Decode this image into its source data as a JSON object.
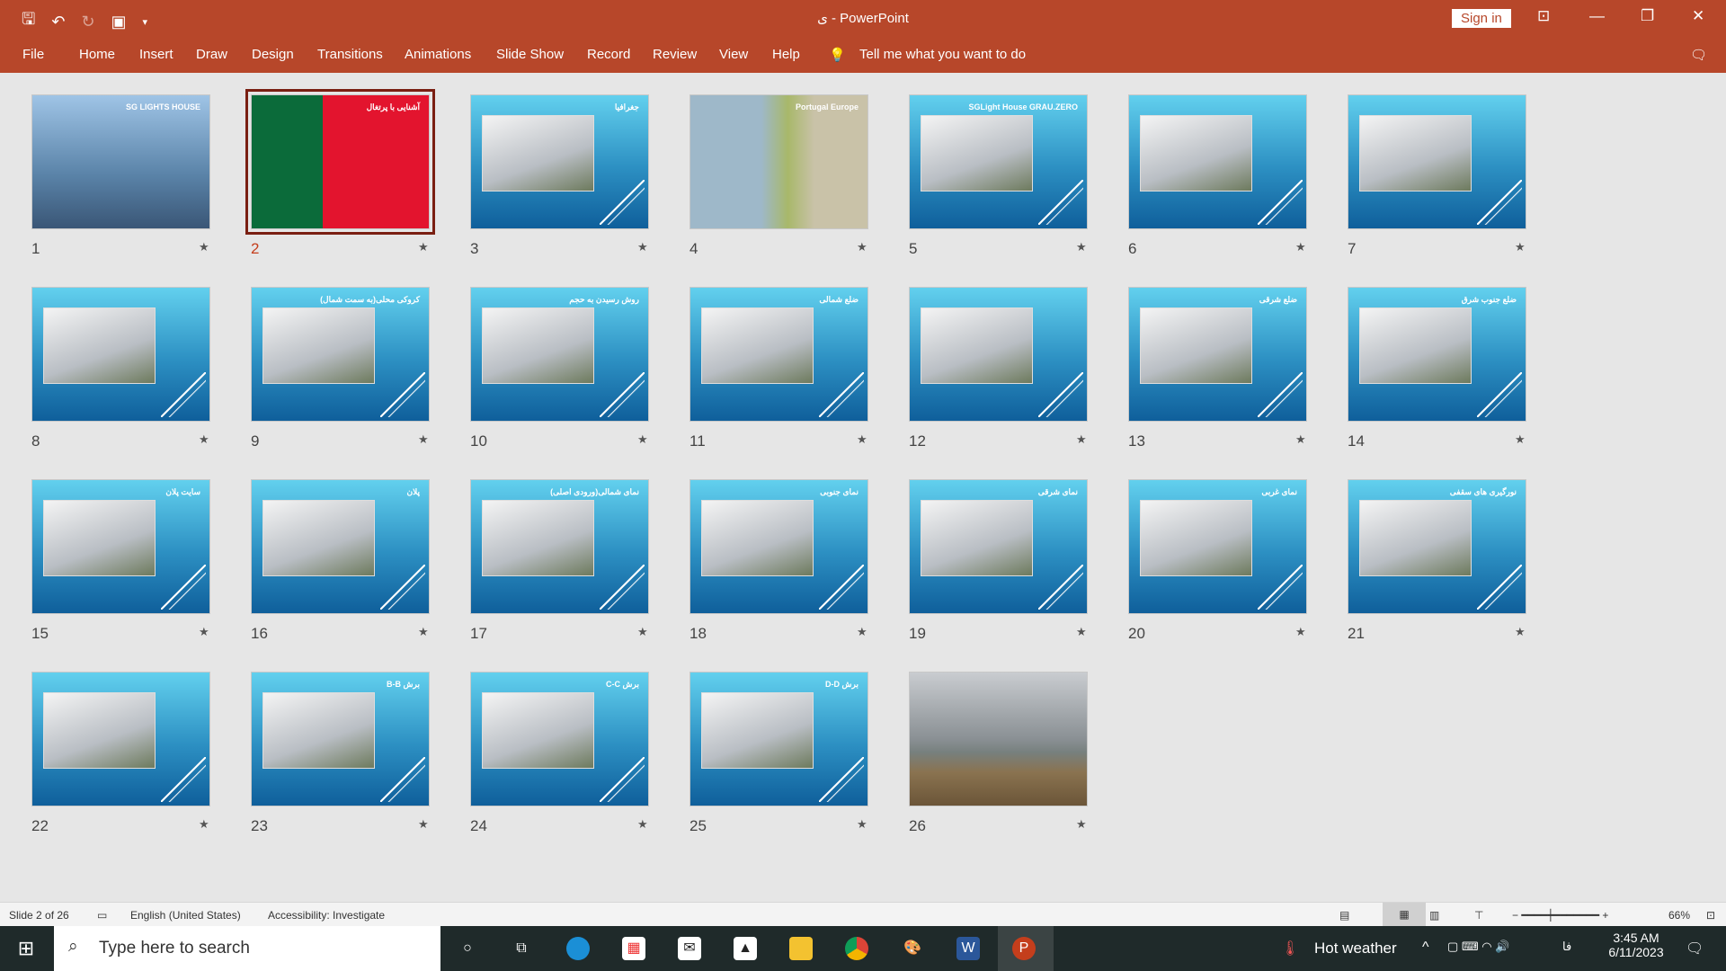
{
  "titlebar": {
    "title": "ی  -  PowerPoint",
    "sign_in": "Sign in",
    "qat": {
      "save": "🖫",
      "undo": "↶",
      "redo": "↻",
      "present": "▣",
      "customize": "▾"
    },
    "controls": {
      "ribbon_display": "⊡",
      "minimize": "—",
      "restore": "❐",
      "close": "✕"
    }
  },
  "menu": {
    "items": [
      "File",
      "Home",
      "Insert",
      "Draw",
      "Design",
      "Transitions",
      "Animations",
      "Slide Show",
      "Record",
      "Review",
      "View",
      "Help"
    ],
    "tell_me": "Tell me what you want to do",
    "lightbulb": "💡",
    "comments": "🗨"
  },
  "colors": {
    "accent": "#b7472a",
    "selected_number": "#c43e1c"
  },
  "slides": [
    {
      "n": "1",
      "title": "SG LIGHTS HOUSE"
    },
    {
      "n": "2",
      "title": "آشنایی با پرتغال",
      "selected": true
    },
    {
      "n": "3",
      "title": "جغرافیا"
    },
    {
      "n": "4",
      "title": "Portugal  Europe"
    },
    {
      "n": "5",
      "title": "SGLight House GRAU.ZERO"
    },
    {
      "n": "6",
      "title": ""
    },
    {
      "n": "7",
      "title": ""
    },
    {
      "n": "8",
      "title": ""
    },
    {
      "n": "9",
      "title": "کروکی محلی(به سمت شمال)"
    },
    {
      "n": "10",
      "title": "روش رسیدن به حجم"
    },
    {
      "n": "11",
      "title": "ضلع شمالی"
    },
    {
      "n": "12",
      "title": ""
    },
    {
      "n": "13",
      "title": "ضلع شرقی"
    },
    {
      "n": "14",
      "title": "ضلع جنوب شرق"
    },
    {
      "n": "15",
      "title": "سایت پلان"
    },
    {
      "n": "16",
      "title": "پلان"
    },
    {
      "n": "17",
      "title": "نمای شمالی(ورودی اصلی)"
    },
    {
      "n": "18",
      "title": "نمای جنوبی"
    },
    {
      "n": "19",
      "title": "نمای شرقی"
    },
    {
      "n": "20",
      "title": "نمای غربی"
    },
    {
      "n": "21",
      "title": "نورگیری های سقفی"
    },
    {
      "n": "22",
      "title": ""
    },
    {
      "n": "23",
      "title": "برش B-B"
    },
    {
      "n": "24",
      "title": "برش C-C"
    },
    {
      "n": "25",
      "title": "برش D-D"
    },
    {
      "n": "26",
      "title": ""
    }
  ],
  "star": "★",
  "status": {
    "slide": "Slide 2 of 26",
    "language": "English (United States)",
    "accessibility": "Accessibility: Investigate",
    "zoom": "66%"
  },
  "taskbar": {
    "search_placeholder": "Type here to search",
    "weather": "Hot weather",
    "time": "3:45 AM",
    "date": "6/11/2023",
    "lang": "فا"
  }
}
